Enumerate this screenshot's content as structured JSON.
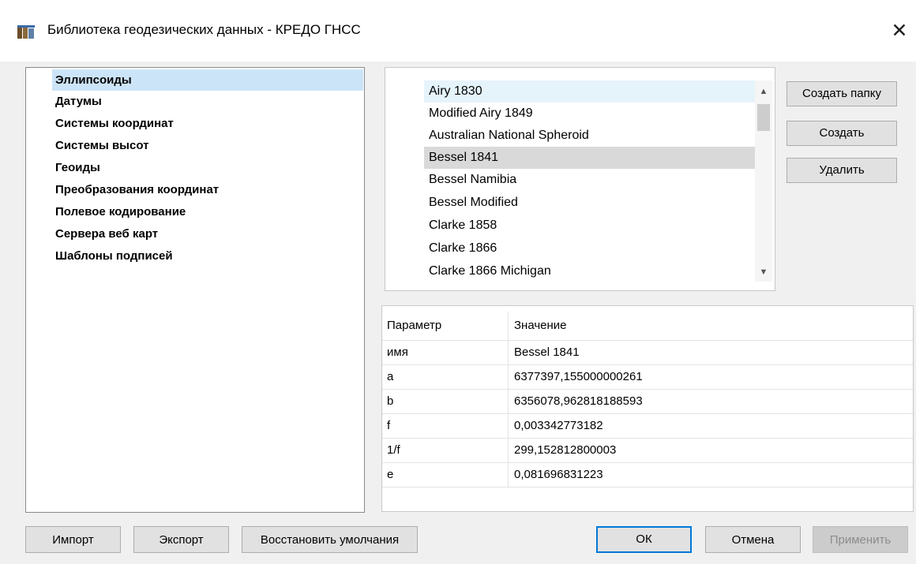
{
  "window": {
    "title": "Библиотека геодезических данных - КРЕДО ГНСС",
    "close_icon": "close-icon",
    "app_icon": "library-icon"
  },
  "nav": {
    "items": [
      {
        "label": "Эллипсоиды",
        "selected": true
      },
      {
        "label": "Датумы"
      },
      {
        "label": "Системы координат"
      },
      {
        "label": "Системы высот"
      },
      {
        "label": "Геоиды"
      },
      {
        "label": "Преобразования координат"
      },
      {
        "label": "Полевое кодирование"
      },
      {
        "label": "Сервера веб карт"
      },
      {
        "label": "Шаблоны подписей"
      }
    ]
  },
  "list": {
    "items": [
      {
        "label": "Airy 1830",
        "state": "hover"
      },
      {
        "label": "Modified Airy 1849"
      },
      {
        "label": "Australian National Spheroid"
      },
      {
        "label": "Bessel 1841",
        "state": "selected"
      },
      {
        "label": "Bessel Namibia"
      },
      {
        "label": "Bessel Modified"
      },
      {
        "label": "Clarke 1858"
      },
      {
        "label": "Clarke 1866"
      },
      {
        "label": "Clarke 1866 Michigan"
      }
    ]
  },
  "actions": {
    "create_folder": "Создать папку",
    "create": "Создать",
    "delete": "Удалить"
  },
  "grid": {
    "headers": {
      "param": "Параметр",
      "value": "Значение"
    },
    "rows": [
      {
        "param": "имя",
        "value": "Bessel 1841"
      },
      {
        "param": "a",
        "value": "6377397,155000000261"
      },
      {
        "param": "b",
        "value": "6356078,962818188593"
      },
      {
        "param": "f",
        "value": "0,003342773182"
      },
      {
        "param": "1/f",
        "value": "299,152812800003"
      },
      {
        "param": "e",
        "value": "0,081696831223"
      }
    ]
  },
  "footer": {
    "import": "Импорт",
    "export": "Экспорт",
    "restore_defaults": "Восстановить умолчания",
    "ok": "ОК",
    "cancel": "Отмена",
    "apply": "Применить"
  },
  "colors": {
    "selection_nav": "#cce4f7",
    "selection_list": "#d9d9d9",
    "hover_list": "#e5f3fb",
    "default_button_border": "#0078d7"
  }
}
